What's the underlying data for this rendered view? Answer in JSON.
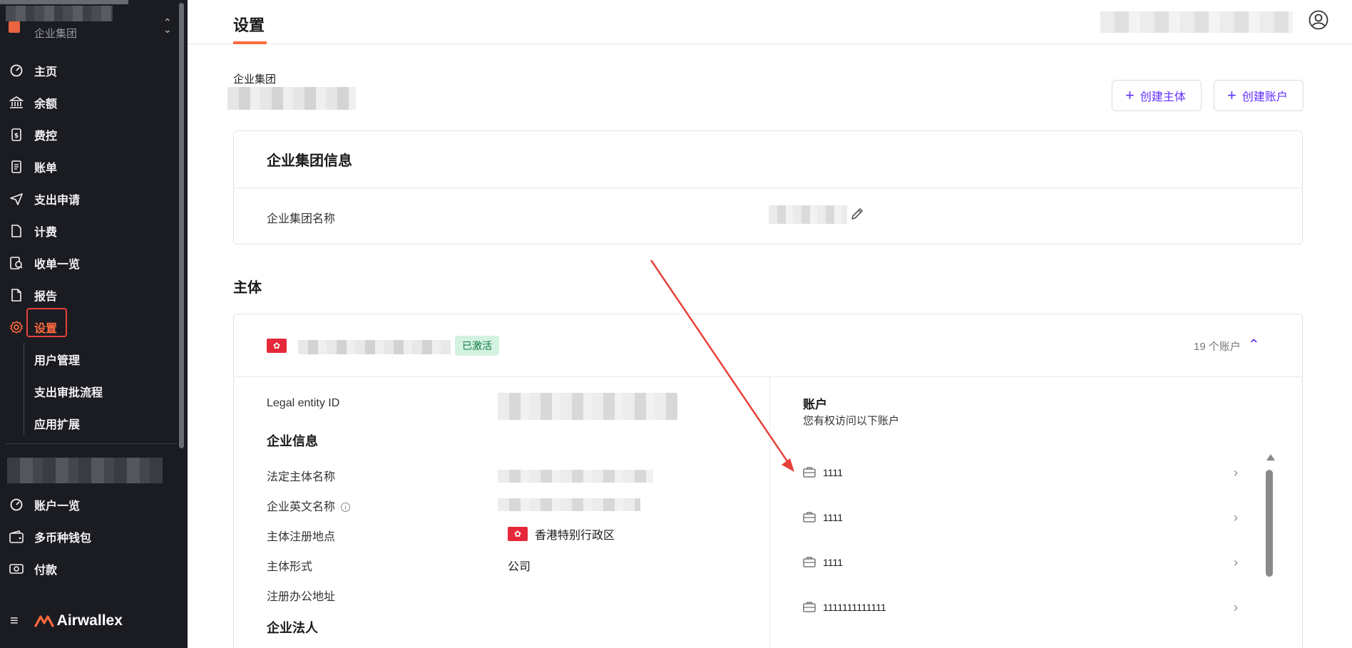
{
  "sidebar": {
    "org_subtitle": "企业集团",
    "items": [
      {
        "label": "主页",
        "icon": "dashboard-icon"
      },
      {
        "label": "余额",
        "icon": "bank-icon"
      },
      {
        "label": "费控",
        "icon": "card-icon"
      },
      {
        "label": "账单",
        "icon": "bill-icon"
      },
      {
        "label": "支出申请",
        "icon": "send-icon"
      },
      {
        "label": "计费",
        "icon": "document-icon"
      },
      {
        "label": "收单一览",
        "icon": "receipt-icon"
      },
      {
        "label": "报告",
        "icon": "report-icon"
      },
      {
        "label": "设置",
        "icon": "gear-icon",
        "active": true
      }
    ],
    "sub_items": [
      {
        "label": "用户管理"
      },
      {
        "label": "支出审批流程"
      },
      {
        "label": "应用扩展"
      }
    ],
    "items2": [
      {
        "label": "账户一览",
        "icon": "dashboard-icon"
      },
      {
        "label": "多币种钱包",
        "icon": "wallet-icon"
      },
      {
        "label": "付款",
        "icon": "cash-icon"
      }
    ],
    "brand": "Airwallex",
    "accent": "#ff6a3d",
    "highlight_color": "#e8413b"
  },
  "header": {
    "title": "设置"
  },
  "group": {
    "label": "企业集团",
    "create_entity_label": "创建主体",
    "create_account_label": "创建账户"
  },
  "group_info": {
    "title": "企业集团信息",
    "name_label": "企业集团名称"
  },
  "entities": {
    "section_title": "主体",
    "status_badge": "已激活",
    "account_count": "19 个账户",
    "details": {
      "legal_id_label": "Legal entity ID",
      "company_info_heading": "企业信息",
      "legal_name_label": "法定主体名称",
      "english_name_label": "企业英文名称",
      "info_glyph": "i",
      "registration_place_label": "主体注册地点",
      "registration_place_value": "香港特别行政区",
      "entity_type_label": "主体形式",
      "entity_type_value": "公司",
      "office_address_label": "注册办公地址",
      "legal_rep_heading": "企业法人"
    },
    "accounts": {
      "title": "账户",
      "subtitle": "您有权访问以下账户",
      "items": [
        "1111",
        "1111",
        "1111",
        "1111111111111"
      ]
    }
  }
}
